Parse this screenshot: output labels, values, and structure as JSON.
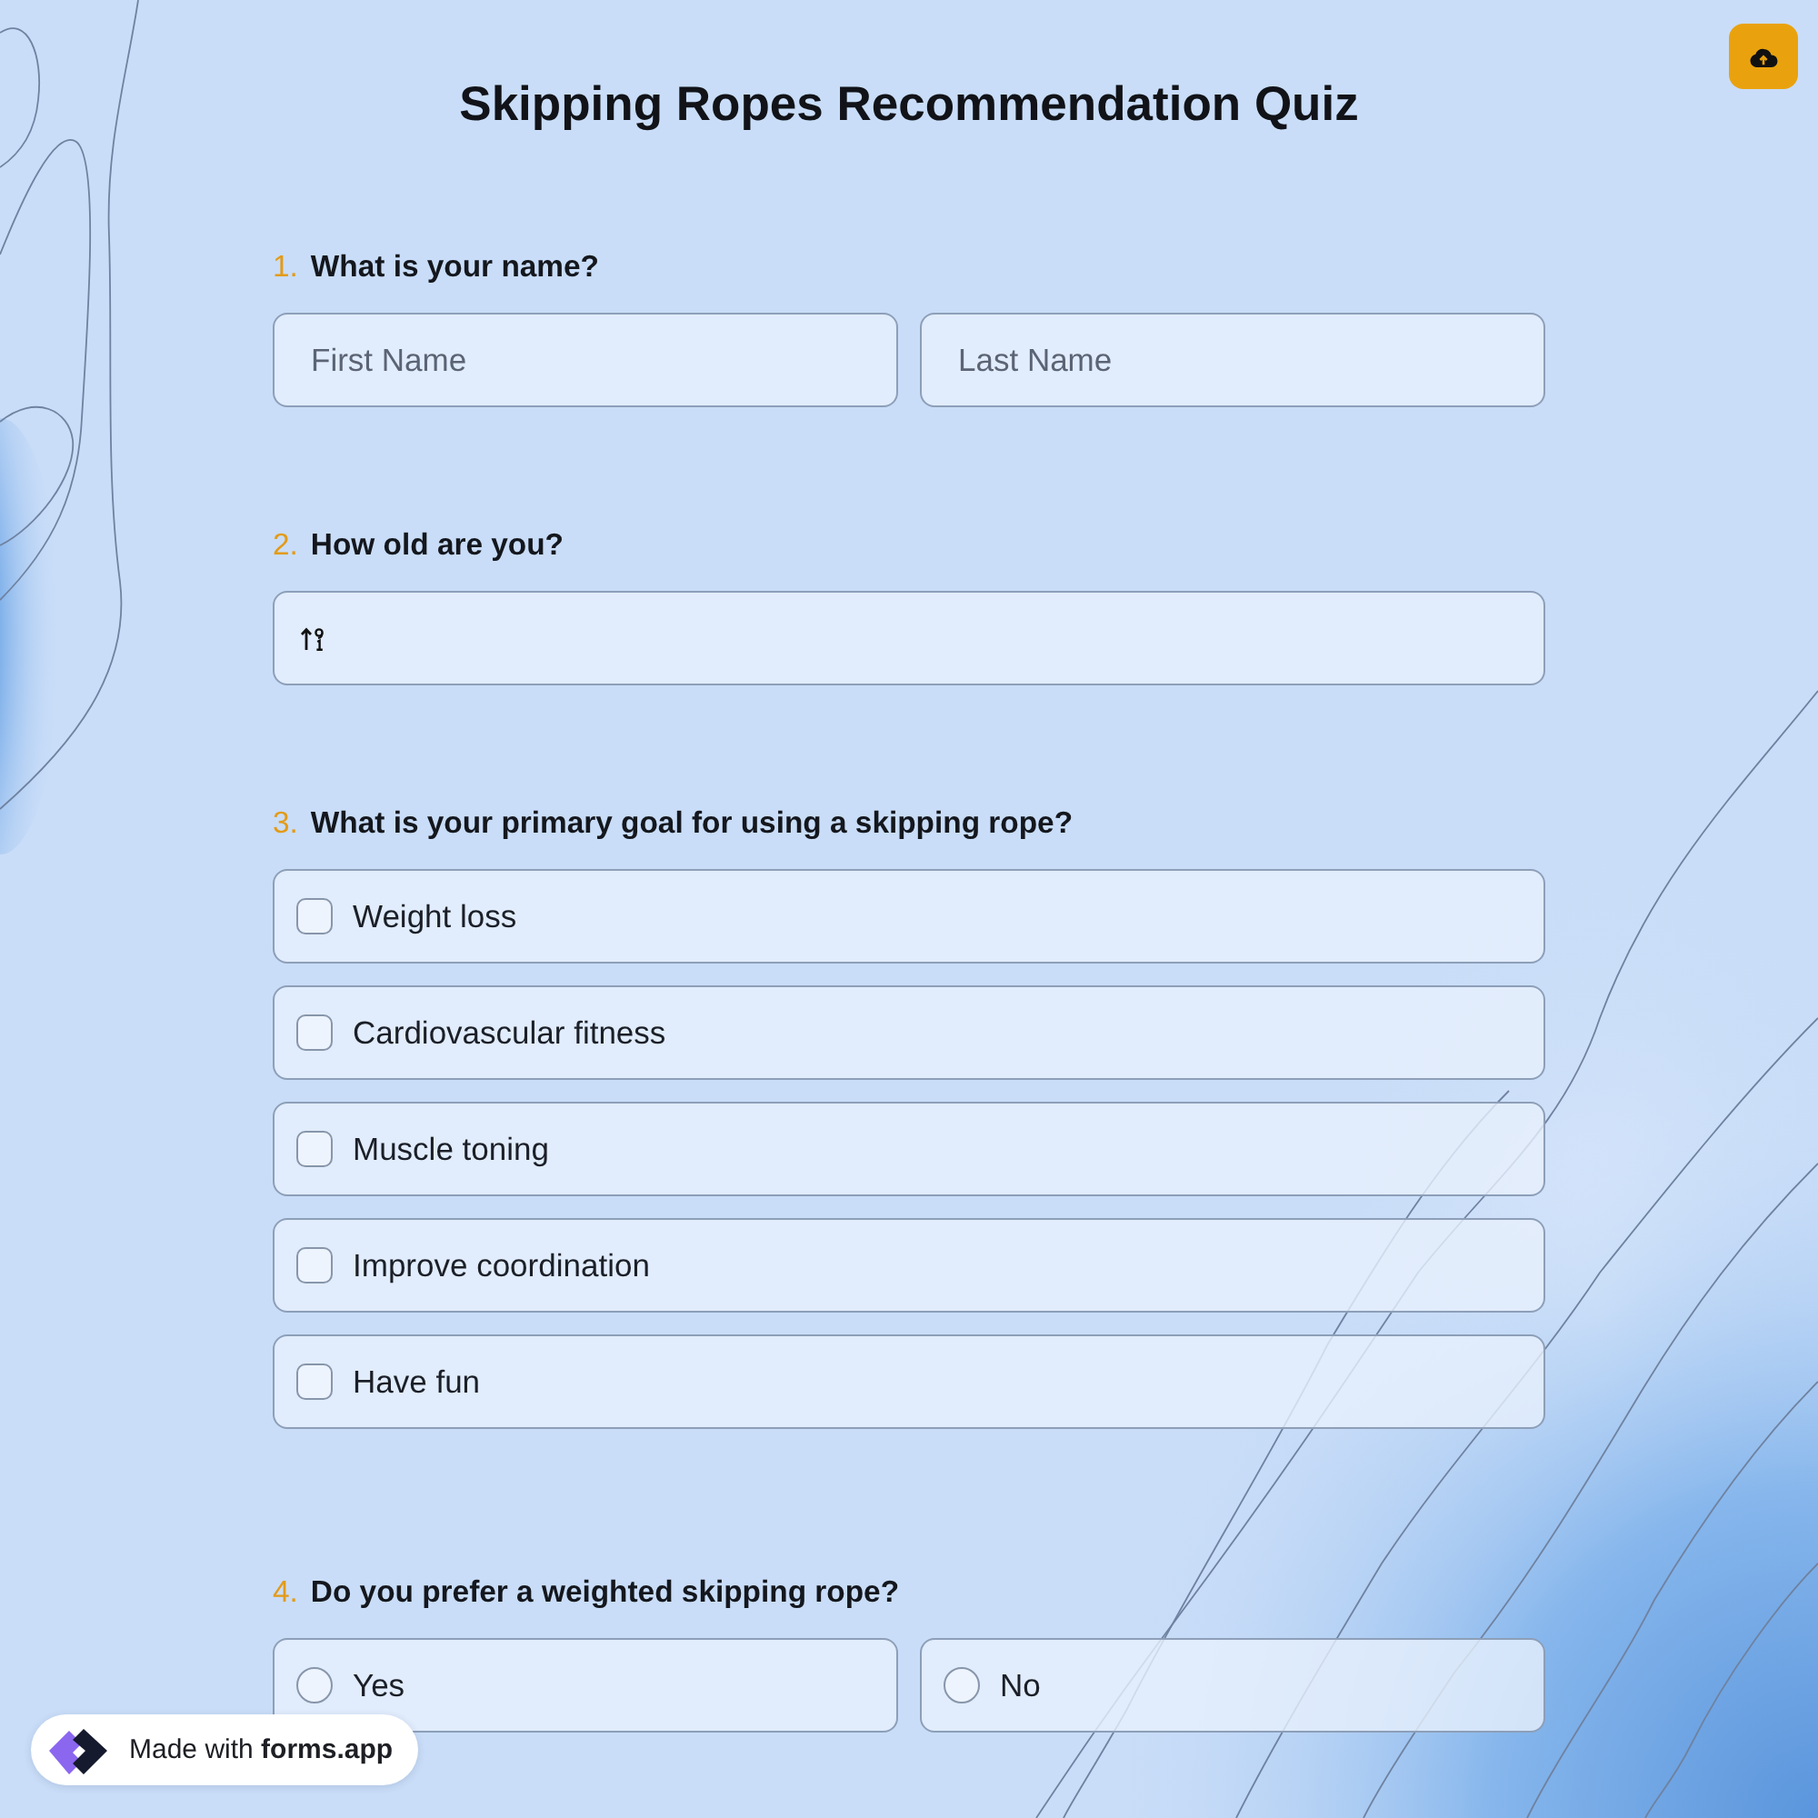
{
  "title": "Skipping Ropes Recommendation Quiz",
  "questions": [
    {
      "number": "1.",
      "text": "What is your name?",
      "kind": "text_pair",
      "fields": [
        {
          "placeholder": "First Name"
        },
        {
          "placeholder": "Last Name"
        }
      ]
    },
    {
      "number": "2.",
      "text": "How old are you?",
      "kind": "number"
    },
    {
      "number": "3.",
      "text": "What is your primary goal for using a skipping rope?",
      "kind": "checkbox",
      "options": [
        {
          "label": "Weight loss",
          "checked": false
        },
        {
          "label": "Cardiovascular fitness",
          "checked": false
        },
        {
          "label": "Muscle toning",
          "checked": false
        },
        {
          "label": "Improve coordination",
          "checked": false
        },
        {
          "label": "Have fun",
          "checked": false
        }
      ]
    },
    {
      "number": "4.",
      "text": "Do you prefer a weighted skipping rope?",
      "kind": "radio",
      "options": [
        {
          "label": "Yes",
          "selected": false
        },
        {
          "label": "No",
          "selected": false
        }
      ]
    }
  ],
  "badge": {
    "text": "Made with **forms.app**"
  }
}
